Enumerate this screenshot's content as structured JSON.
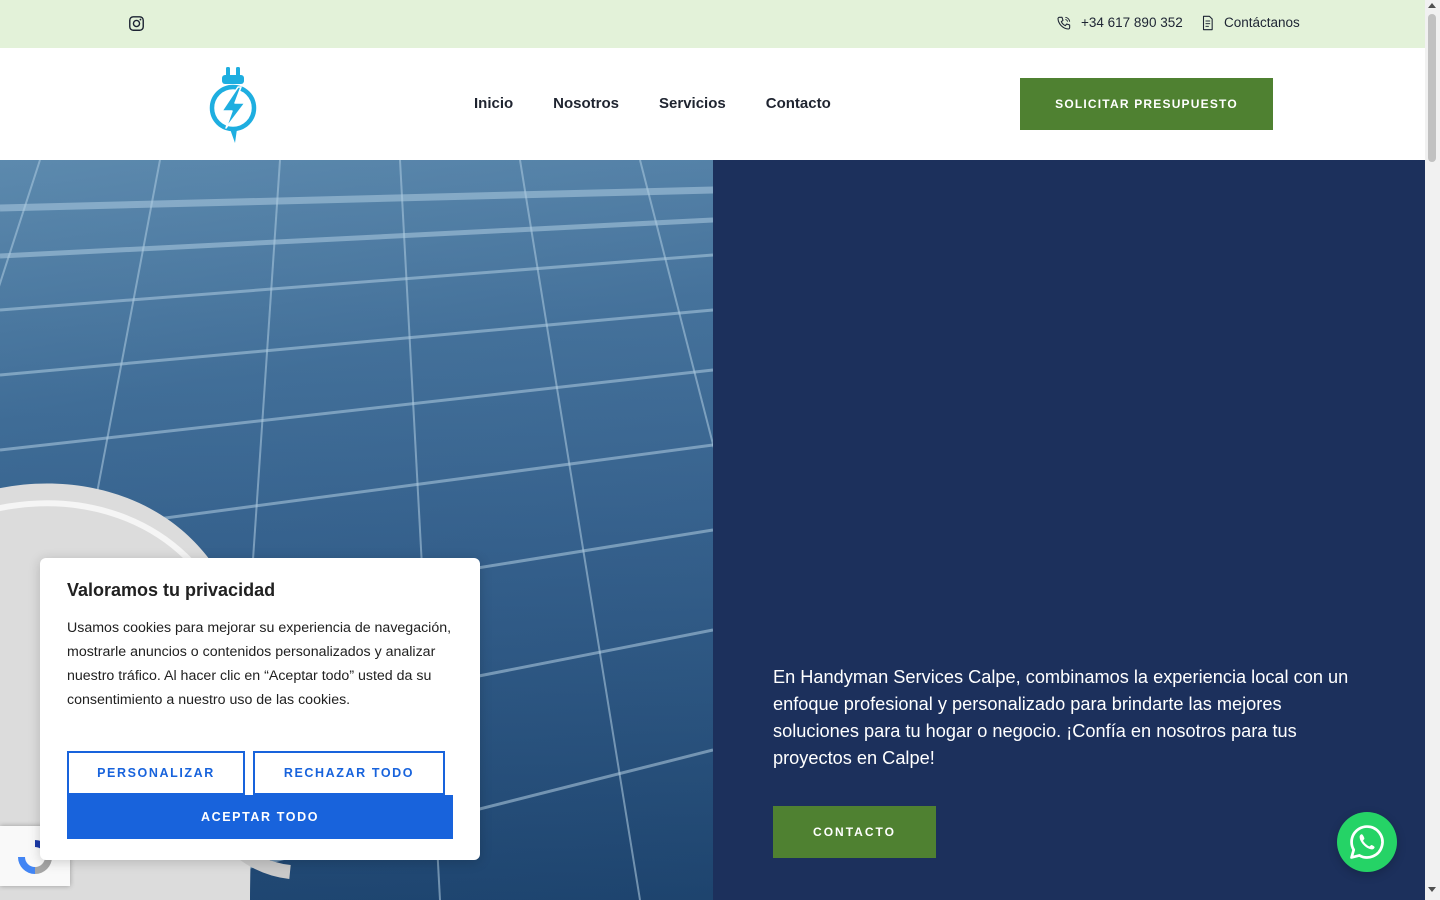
{
  "topbar": {
    "phone": "+34 617 890 352",
    "contact_label": "Contáctanos",
    "social_icon": "instagram-icon"
  },
  "header": {
    "logo_icon": "electric-plug-bolt-logo",
    "nav": [
      {
        "label": "Inicio"
      },
      {
        "label": "Nosotros"
      },
      {
        "label": "Servicios"
      },
      {
        "label": "Contacto"
      }
    ],
    "cta_label": "SOLICITAR PRESUPUESTO"
  },
  "hero": {
    "description": "En Handyman Services Calpe, combinamos la experiencia local con un enfoque profesional y personalizado para brindarte las mejores soluciones para tu hogar o negocio. ¡Confía en nosotros para tus proyectos en Calpe!",
    "button_label": "CONTACTO"
  },
  "cookie": {
    "title": "Valoramos tu privacidad",
    "text": "Usamos cookies para mejorar su experiencia de navegación, mostrarle anuncios o contenidos personalizados y analizar nuestro tráfico. Al hacer clic en “Aceptar todo” usted da su consentimiento a nuestro uso de las cookies.",
    "customize_label": "PERSONALIZAR",
    "reject_label": "RECHAZAR TODO",
    "accept_label": "ACEPTAR TODO"
  },
  "colors": {
    "topbar_bg": "#e3f2d9",
    "brand_green": "#4f8131",
    "hero_navy": "#1c305c",
    "cookie_blue": "#1863dc",
    "whatsapp_green": "#25d366",
    "logo_cyan": "#1eaee0"
  }
}
